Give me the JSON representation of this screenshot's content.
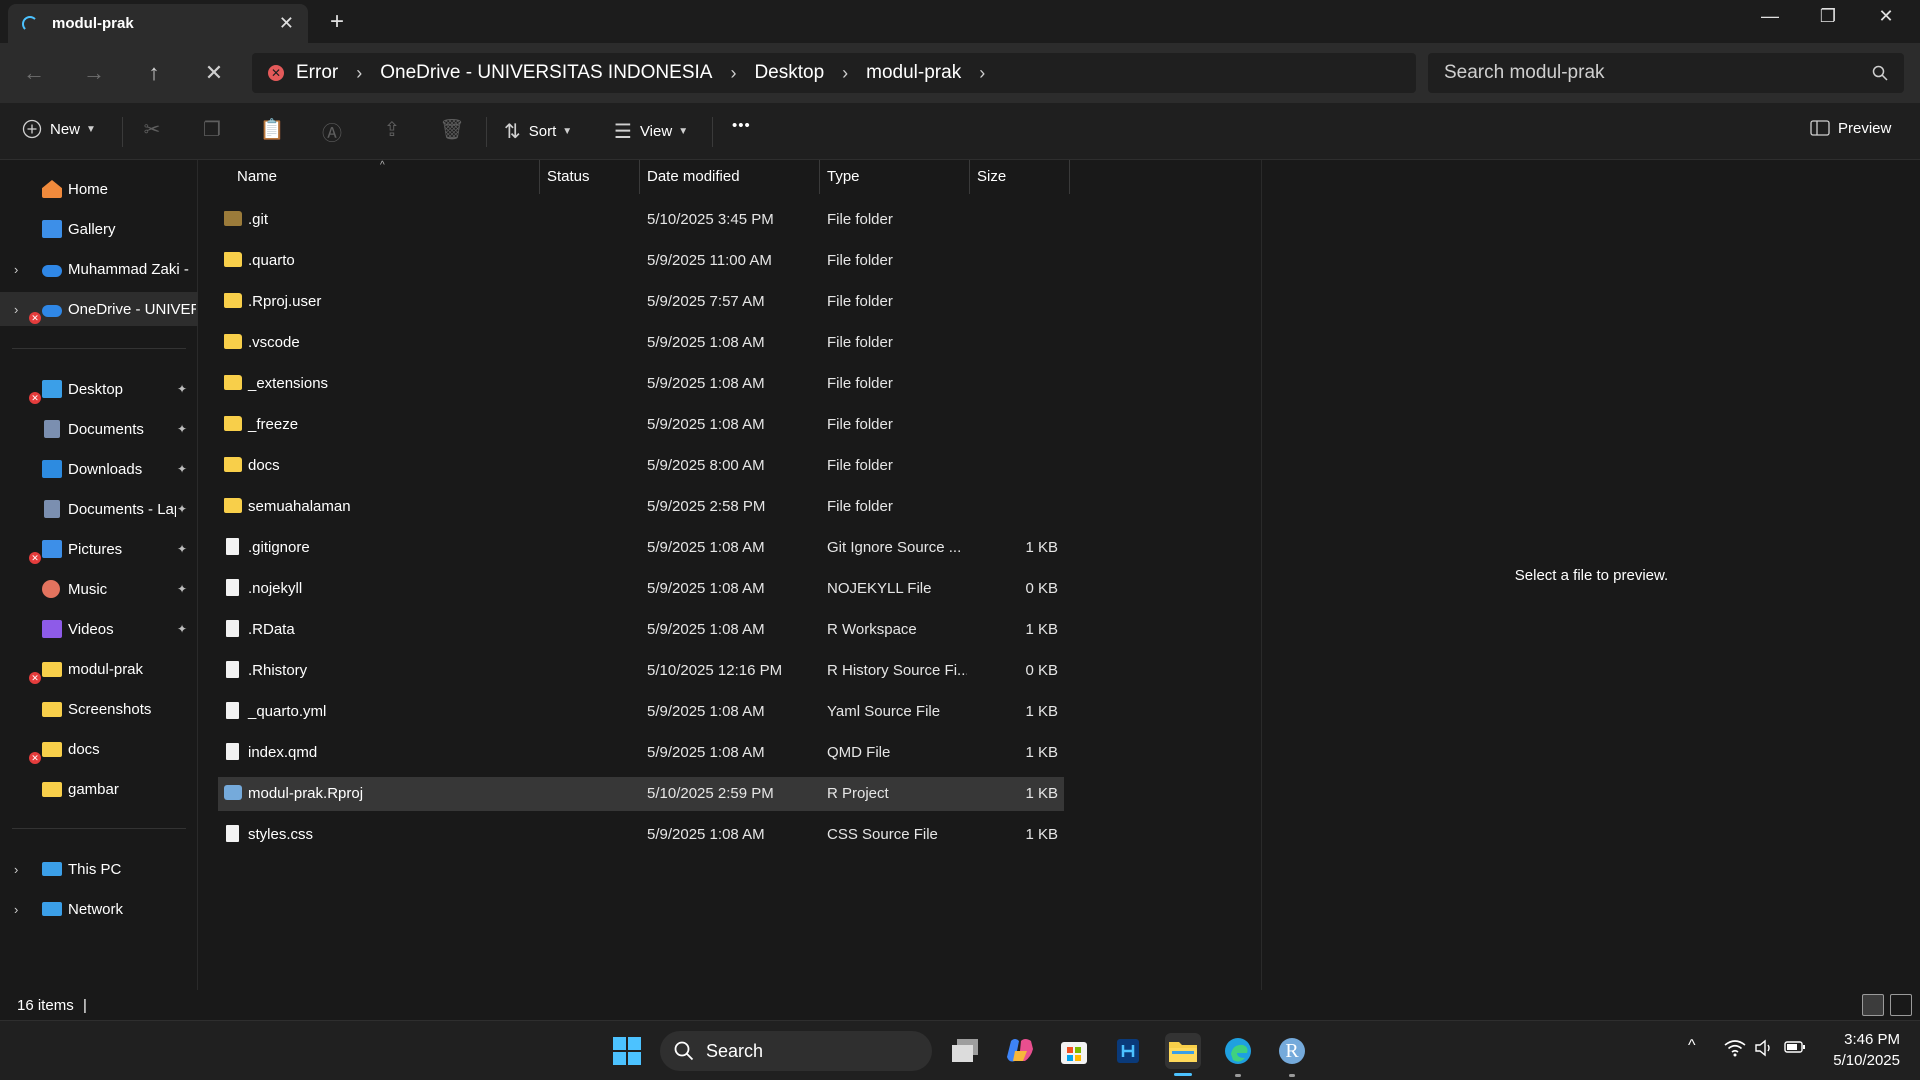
{
  "window": {
    "tab_title": "modul-prak",
    "tab_close": "✕",
    "new_tab": "+",
    "minimize": "—",
    "restore": "❐",
    "close": "✕"
  },
  "nav": {
    "back": "←",
    "forward": "→",
    "up": "↑",
    "stop": "✕"
  },
  "breadcrumb": {
    "error_label": "Error",
    "items": [
      "OneDrive - UNIVERSITAS INDONESIA",
      "Desktop",
      "modul-prak"
    ],
    "sep": "›"
  },
  "search": {
    "placeholder": "Search modul-prak",
    "icon": "search-icon"
  },
  "commands": {
    "new_label": "New",
    "sort_label": "Sort",
    "view_label": "View",
    "more": "•••",
    "preview_label": "Preview"
  },
  "sidebar": {
    "items": [
      {
        "label": "Home",
        "color": "#f08a3c"
      },
      {
        "label": "Gallery",
        "color": "#3d8fe8"
      },
      {
        "label": "Muhammad Zaki -",
        "color": "#2f87e6"
      },
      {
        "label": "OneDrive - UNIVERSITAS INDONESIA",
        "color": "#2f87e6"
      },
      {
        "label": "Desktop",
        "color": "#3b9fe8"
      },
      {
        "label": "Documents",
        "color": "#7b8fb0"
      },
      {
        "label": "Downloads",
        "color": "#2d8be0"
      },
      {
        "label": "Documents - Laptop",
        "color": "#7b8fb0"
      },
      {
        "label": "Pictures",
        "color": "#3d8fe8"
      },
      {
        "label": "Music",
        "color": "#e3735e"
      },
      {
        "label": "Videos",
        "color": "#8e5be8"
      },
      {
        "label": "modul-prak",
        "color": "#f8cf4a"
      },
      {
        "label": "Screenshots",
        "color": "#f8cf4a"
      },
      {
        "label": "docs",
        "color": "#f8cf4a"
      },
      {
        "label": "gambar",
        "color": "#f8cf4a"
      },
      {
        "label": "This PC",
        "color": "#3b9fe8"
      },
      {
        "label": "Network",
        "color": "#3b9fe8"
      }
    ],
    "expander": "›",
    "pin": "📌"
  },
  "columns": {
    "name": "Name",
    "status": "Status",
    "date": "Date modified",
    "type": "Type",
    "size": "Size",
    "sort_indicator": "^"
  },
  "files": [
    {
      "name": ".git",
      "date": "5/10/2025 3:45 PM",
      "type": "File folder",
      "size": "",
      "kind": "folder-dim"
    },
    {
      "name": ".quarto",
      "date": "5/9/2025 11:00 AM",
      "type": "File folder",
      "size": "",
      "kind": "folder"
    },
    {
      "name": ".Rproj.user",
      "date": "5/9/2025 7:57 AM",
      "type": "File folder",
      "size": "",
      "kind": "folder"
    },
    {
      "name": ".vscode",
      "date": "5/9/2025 1:08 AM",
      "type": "File folder",
      "size": "",
      "kind": "folder"
    },
    {
      "name": "_extensions",
      "date": "5/9/2025 1:08 AM",
      "type": "File folder",
      "size": "",
      "kind": "folder"
    },
    {
      "name": "_freeze",
      "date": "5/9/2025 1:08 AM",
      "type": "File folder",
      "size": "",
      "kind": "folder"
    },
    {
      "name": "docs",
      "date": "5/9/2025 8:00 AM",
      "type": "File folder",
      "size": "",
      "kind": "folder"
    },
    {
      "name": "semuahalaman",
      "date": "5/9/2025 2:58 PM",
      "type": "File folder",
      "size": "",
      "kind": "folder"
    },
    {
      "name": ".gitignore",
      "date": "5/9/2025 1:08 AM",
      "type": "Git Ignore Source ...",
      "size": "1 KB",
      "kind": "file"
    },
    {
      "name": ".nojekyll",
      "date": "5/9/2025 1:08 AM",
      "type": "NOJEKYLL File",
      "size": "0 KB",
      "kind": "file"
    },
    {
      "name": ".RData",
      "date": "5/9/2025 1:08 AM",
      "type": "R Workspace",
      "size": "1 KB",
      "kind": "file"
    },
    {
      "name": ".Rhistory",
      "date": "5/10/2025 12:16 PM",
      "type": "R History Source Fi...",
      "size": "0 KB",
      "kind": "file"
    },
    {
      "name": "_quarto.yml",
      "date": "5/9/2025 1:08 AM",
      "type": "Yaml Source File",
      "size": "1 KB",
      "kind": "file"
    },
    {
      "name": "index.qmd",
      "date": "5/9/2025 1:08 AM",
      "type": "QMD File",
      "size": "1 KB",
      "kind": "file"
    },
    {
      "name": "modul-prak.Rproj",
      "date": "5/10/2025 2:59 PM",
      "type": "R Project",
      "size": "1 KB",
      "kind": "rproj"
    },
    {
      "name": "styles.css",
      "date": "5/9/2025 1:08 AM",
      "type": "CSS Source File",
      "size": "1 KB",
      "kind": "file"
    }
  ],
  "preview": {
    "message": "Select a file to preview."
  },
  "status": {
    "count": "16 items",
    "cursor": "|"
  },
  "taskbar": {
    "search_label": "Search",
    "clock_time": "3:46 PM",
    "clock_date": "5/10/2025",
    "tray_chevron": "^",
    "r_letter": "R"
  },
  "colors": {
    "accent": "#4cc2ff",
    "folder": "#f8cf4a",
    "error": "#e43c3c",
    "selection": "#373737"
  }
}
